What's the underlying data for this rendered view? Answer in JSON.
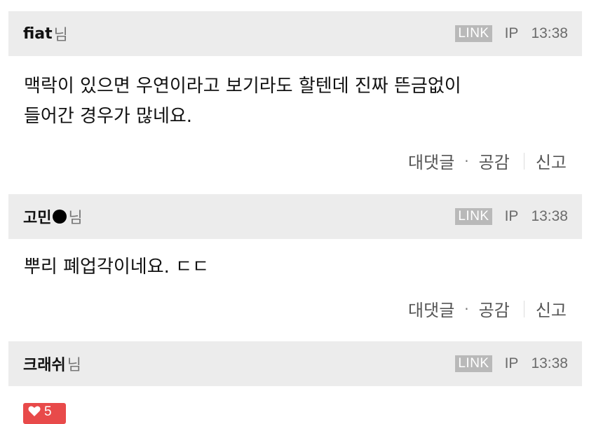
{
  "comments": [
    {
      "nickname": "fiat",
      "honorific": "님",
      "link": "LINK",
      "ip": "IP",
      "time": "13:38",
      "body_lines": [
        "맥락이 있으면 우연이라고 보기라도 할텐데 진짜 뜬금없이",
        "들어간 경우가 많네요."
      ],
      "reply": "대댓글",
      "like": "공감",
      "report": "신고"
    },
    {
      "nickname": "고민",
      "honorific": "님",
      "link": "LINK",
      "ip": "IP",
      "time": "13:38",
      "body_lines": [
        "뿌리 폐업각이네요. ㄷㄷ"
      ],
      "reply": "대댓글",
      "like": "공감",
      "report": "신고"
    },
    {
      "nickname": "크래쉬",
      "honorific": "님",
      "link": "LINK",
      "ip": "IP",
      "time": "13:38"
    }
  ],
  "like_badge": {
    "count": "5",
    "color": "#e84a4a"
  }
}
